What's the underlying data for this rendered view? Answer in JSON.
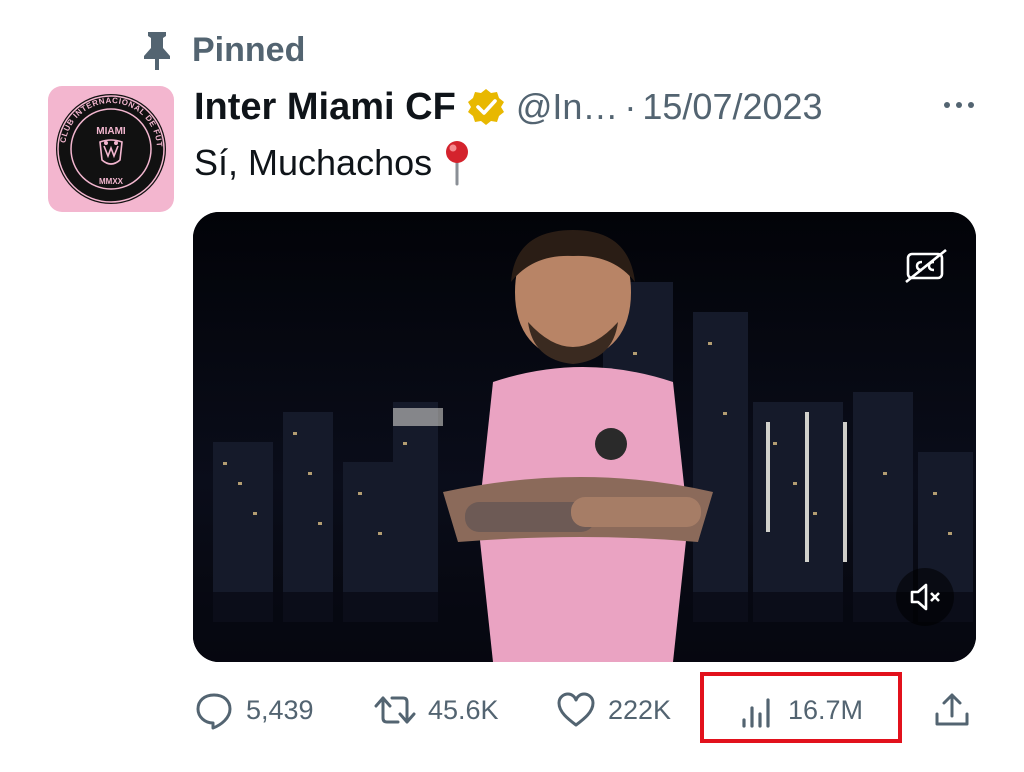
{
  "pinned": {
    "label": "Pinned"
  },
  "tweet": {
    "author": {
      "display_name": "Inter Miami CF",
      "handle": "@In…",
      "avatar": {
        "ring_text": "CLUB INTERNACIONAL DE FÚTBOL",
        "wordmark": "MIAMI",
        "year": "MMXX"
      }
    },
    "separator": "·",
    "date": "15/07/2023",
    "text": "Sí, Muchachos",
    "emoji": "round-pushpin",
    "media": {
      "type": "video"
    }
  },
  "actions": {
    "replies": "5,439",
    "retweets": "45.6K",
    "likes": "222K",
    "views": "16.7M"
  },
  "colors": {
    "secondary_text": "#536471",
    "highlight": "#e2111c",
    "verified": "#e8b800",
    "avatar_bg": "#f3b6cf"
  }
}
